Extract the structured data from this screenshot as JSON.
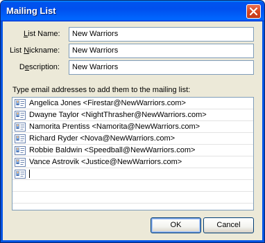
{
  "window": {
    "title": "Mailing List"
  },
  "form": {
    "list_name": {
      "label": "List Name:",
      "mnemonic": "L",
      "rest": "ist Name:",
      "value": "New Warriors"
    },
    "list_nickname": {
      "label": "List Nickname:",
      "prefix": "List ",
      "mnemonic": "N",
      "rest": "ickname:",
      "value": "New Warriors"
    },
    "description": {
      "label": "Description:",
      "prefix": "D",
      "mnemonic": "e",
      "rest": "scription:",
      "value": "New Warriors"
    }
  },
  "list": {
    "instruction": "Type email addresses to add them to the mailing list:",
    "entries": [
      "Angelica Jones <Firestar@NewWarriors.com>",
      "Dwayne Taylor <NightThrasher@NewWarriors.com>",
      "Namorita Prentiss <Namorita@NewWarriors.com>",
      "Richard Ryder <Nova@NewWarriors.com>",
      "Robbie Baldwin <Speedball@NewWarriors.com>",
      "Vance Astrovik <Justice@NewWarriors.com>"
    ]
  },
  "buttons": {
    "ok": "OK",
    "cancel": "Cancel"
  },
  "icons": {
    "close": "close-icon",
    "contact": "contact-card-icon"
  }
}
